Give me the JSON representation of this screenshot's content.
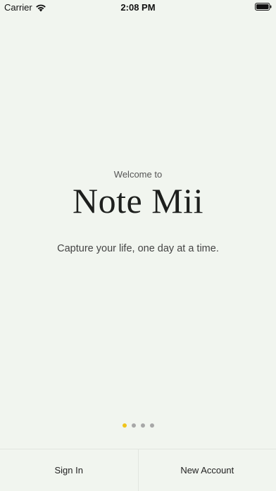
{
  "status_bar": {
    "carrier": "Carrier",
    "time": "2:08 PM"
  },
  "hero": {
    "welcome": "Welcome to",
    "app_name": "Note Mii",
    "tagline": "Capture your life, one day at a time."
  },
  "pager": {
    "count": 4,
    "active_index": 0
  },
  "actions": {
    "sign_in": "Sign In",
    "new_account": "New Account"
  },
  "colors": {
    "background": "#f1f5ef",
    "active_dot": "#f0c41b",
    "inactive_dot": "#a7a7a7"
  }
}
